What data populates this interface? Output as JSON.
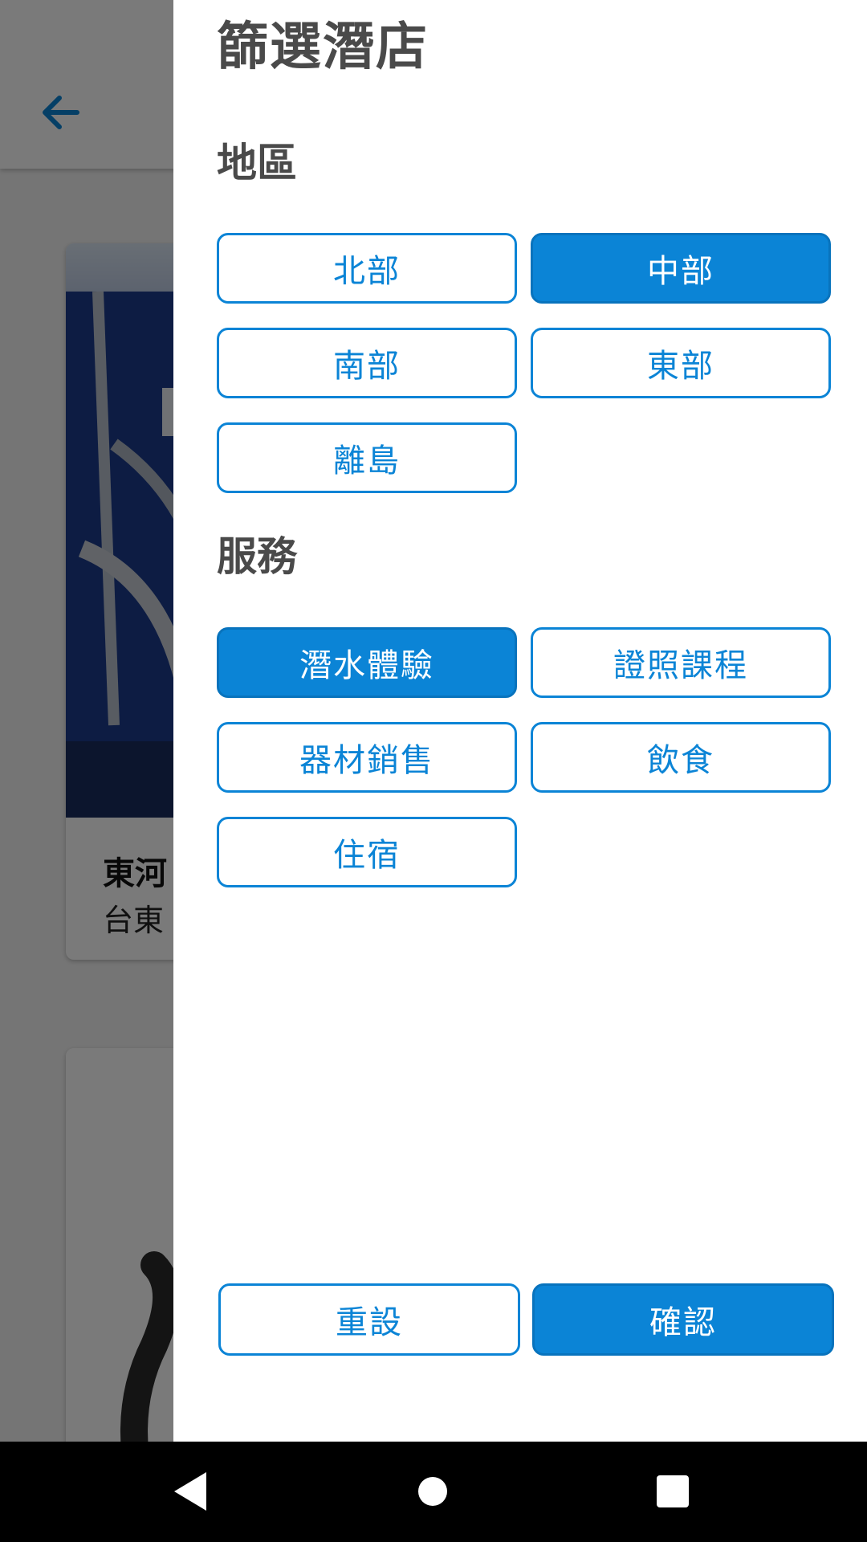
{
  "app": {
    "back_icon": "arrow-left-icon",
    "accent_color": "#0b84d6"
  },
  "background_card": {
    "title": "東河",
    "subtitle": "台東"
  },
  "drawer": {
    "title": "篩選潛店",
    "region": {
      "heading": "地區",
      "options": [
        {
          "label": "北部",
          "selected": false
        },
        {
          "label": "中部",
          "selected": true
        },
        {
          "label": "南部",
          "selected": false
        },
        {
          "label": "東部",
          "selected": false
        },
        {
          "label": "離島",
          "selected": false
        }
      ]
    },
    "service": {
      "heading": "服務",
      "options": [
        {
          "label": "潛水體驗",
          "selected": true
        },
        {
          "label": "證照課程",
          "selected": false
        },
        {
          "label": "器材銷售",
          "selected": false
        },
        {
          "label": "飲食",
          "selected": false
        },
        {
          "label": "住宿",
          "selected": false
        }
      ]
    },
    "reset_label": "重設",
    "confirm_label": "確認"
  },
  "navbar": {
    "back_icon": "triangle-back-icon",
    "home_icon": "circle-home-icon",
    "recents_icon": "square-recents-icon"
  }
}
